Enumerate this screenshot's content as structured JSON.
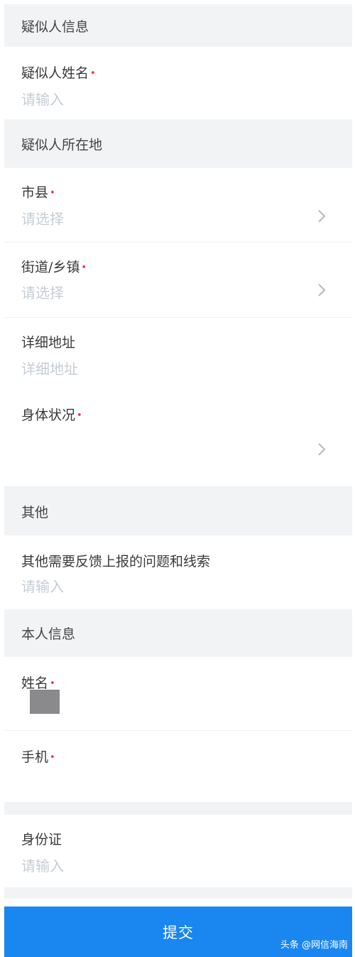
{
  "sections": {
    "suspect_info": "疑似人信息",
    "suspect_location": "疑似人所在地",
    "other": "其他",
    "self_info": "本人信息"
  },
  "fields": {
    "suspect_name": {
      "label": "疑似人姓名",
      "placeholder": "请输入"
    },
    "city_county": {
      "label": "市县",
      "placeholder": "请选择"
    },
    "street_town": {
      "label": "街道/乡镇",
      "placeholder": "请选择"
    },
    "address": {
      "label": "详细地址",
      "placeholder": "详细地址"
    },
    "health": {
      "label": "身体状况",
      "placeholder": ""
    },
    "other_issues": {
      "label": "其他需要反馈上报的问题和线索",
      "placeholder": "请输入"
    },
    "name": {
      "label": "姓名",
      "placeholder": ""
    },
    "phone": {
      "label": "手机",
      "placeholder": ""
    },
    "id_card": {
      "label": "身份证",
      "placeholder": "请输入"
    }
  },
  "required_mark": "•",
  "submit_label": "提交",
  "watermark": "头条 @网信海南",
  "colors": {
    "accent": "#1a86f0",
    "required": "#ee3344",
    "section_bg": "#f2f3f5",
    "placeholder": "#c6ccd4"
  },
  "icons": {
    "chevron": "chevron-right-icon"
  }
}
